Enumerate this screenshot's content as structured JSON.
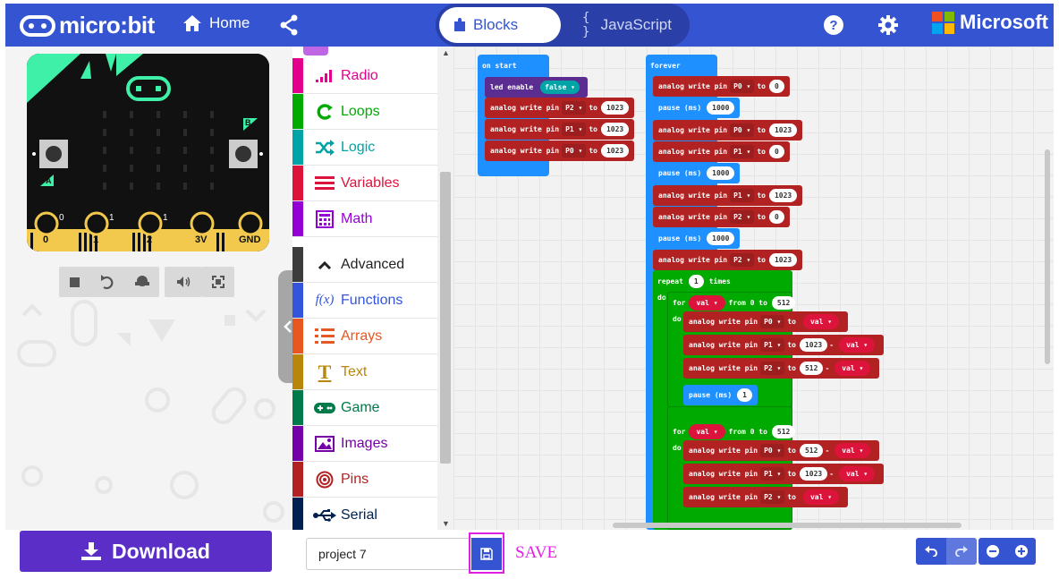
{
  "header": {
    "brand": "micro:bit",
    "home_label": "Home",
    "mode_blocks": "Blocks",
    "mode_javascript": "JavaScript",
    "js_glyph": "{ }",
    "microsoft": "Microsoft",
    "colors": {
      "bar": "#3454d1"
    }
  },
  "simulator": {
    "buttons": {
      "a": "A",
      "b": "B"
    },
    "pins": [
      "0",
      "1",
      "2",
      "3V",
      "GND"
    ],
    "pin_labels_small": [
      "0",
      "1",
      "1"
    ],
    "controls": [
      "stop-icon",
      "restart-icon",
      "debug-icon",
      "mute-icon",
      "fullscreen-icon"
    ]
  },
  "toolbox": {
    "categories": [
      {
        "label": "Radio",
        "color": "#e3008c",
        "icon": "signal-icon"
      },
      {
        "label": "Loops",
        "color": "#00aa00",
        "icon": "loop-icon"
      },
      {
        "label": "Logic",
        "color": "#00a4a6",
        "icon": "shuffle-icon"
      },
      {
        "label": "Variables",
        "color": "#dc143c",
        "icon": "list-icon"
      },
      {
        "label": "Math",
        "color": "#9400d3",
        "icon": "calculator-icon"
      },
      {
        "label": "Advanced",
        "color": "#3c3c3c",
        "icon": "chevron-up-icon"
      },
      {
        "label": "Functions",
        "color": "#3455db",
        "icon": "function-icon"
      },
      {
        "label": "Arrays",
        "color": "#e65722",
        "icon": "numbered-list-icon"
      },
      {
        "label": "Text",
        "color": "#b8860b",
        "icon": "text-icon"
      },
      {
        "label": "Game",
        "color": "#007a4b",
        "icon": "gamepad-icon"
      },
      {
        "label": "Images",
        "color": "#7600a8",
        "icon": "image-icon"
      },
      {
        "label": "Pins",
        "color": "#b22222",
        "icon": "target-icon"
      },
      {
        "label": "Serial",
        "color": "#002050",
        "icon": "usb-icon"
      }
    ]
  },
  "workspace": {
    "on_start": {
      "title": "on start",
      "led_enable": "led enable",
      "led_value": "false",
      "writes": [
        {
          "pin": "P2",
          "value": "1023"
        },
        {
          "pin": "P1",
          "value": "1023"
        },
        {
          "pin": "P0",
          "value": "1023"
        }
      ]
    },
    "forever": {
      "title": "forever",
      "analog_label": "analog write pin",
      "to_label": "to",
      "pause_label": "pause (ms)",
      "rows": [
        {
          "kind": "write",
          "pin": "P0",
          "value": "0"
        },
        {
          "kind": "pause",
          "value": "1000"
        },
        {
          "kind": "write",
          "pin": "P0",
          "value": "1023"
        },
        {
          "kind": "write",
          "pin": "P1",
          "value": "0"
        },
        {
          "kind": "pause",
          "value": "1000"
        },
        {
          "kind": "write",
          "pin": "P1",
          "value": "1023"
        },
        {
          "kind": "write",
          "pin": "P2",
          "value": "0"
        },
        {
          "kind": "pause",
          "value": "1000"
        },
        {
          "kind": "write",
          "pin": "P2",
          "value": "1023"
        }
      ],
      "repeat_label": "repeat",
      "repeat_count": "1",
      "times_label": "times",
      "do_label": "do",
      "for_label": "for",
      "var_name": "val",
      "from_label": "from 0 to",
      "loop_max": "512",
      "loop1": [
        {
          "pin": "P0",
          "expr": [
            "val"
          ]
        },
        {
          "pin": "P1",
          "expr": [
            "1023",
            "-",
            "val"
          ]
        },
        {
          "pin": "P2",
          "expr": [
            "512",
            "-",
            "val"
          ]
        }
      ],
      "loop1_pause": "1",
      "loop2": [
        {
          "pin": "P0",
          "expr": [
            "512",
            "-",
            "val"
          ]
        },
        {
          "pin": "P1",
          "expr": [
            "1023",
            "-",
            "val"
          ]
        },
        {
          "pin": "P2",
          "expr": [
            "val"
          ]
        }
      ]
    }
  },
  "footer": {
    "download_label": "Download",
    "project_name": "project 7",
    "save_label": "SAVE",
    "controls": [
      "undo-icon",
      "redo-icon",
      "zoom-out-icon",
      "zoom-in-icon"
    ]
  }
}
